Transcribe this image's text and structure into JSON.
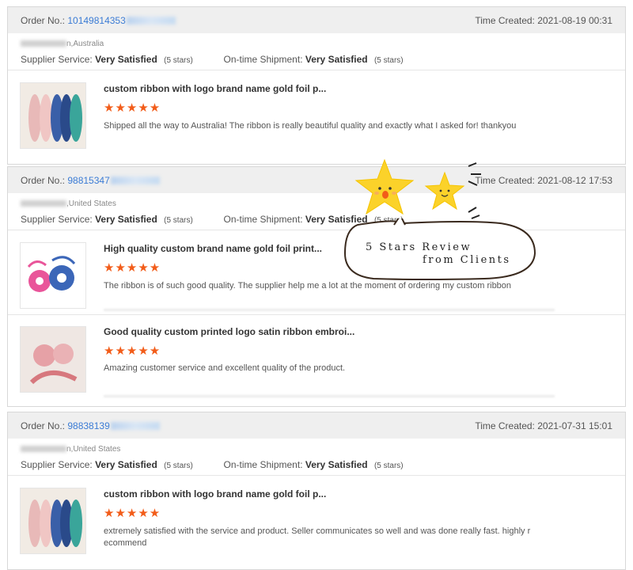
{
  "orders": [
    {
      "order_label": "Order No.:",
      "order_number": "10149814353",
      "time_label": "Time Created:",
      "time_value": "2021-08-19 00:31",
      "country": "n,Australia",
      "supplier_label": "Supplier Service:",
      "supplier_value": "Very Satisfied",
      "supplier_stars": "(5 stars)",
      "shipment_label": "On-time Shipment:",
      "shipment_value": "Very Satisfied",
      "shipment_stars": "(5 stars)",
      "products": [
        {
          "title": "custom ribbon with logo brand name gold foil p...",
          "stars": "★★★★★",
          "comment": "Shipped all the way to Australia! The ribbon is really beautiful quality and exactly what I asked for! thankyou",
          "thumb": "ribbon-rolls-photo"
        }
      ]
    },
    {
      "order_label": "Order No.:",
      "order_number": "98815347",
      "time_label": "Time Created:",
      "time_value": "2021-08-12 17:53",
      "country": ",United States",
      "supplier_label": "Supplier Service:",
      "supplier_value": "Very Satisfied",
      "supplier_stars": "(5 stars)",
      "shipment_label": "On-time Shipment:",
      "shipment_value": "Very Satisfied",
      "shipment_stars": "(5 stars)",
      "products": [
        {
          "title": "High quality custom brand name gold foil print...",
          "stars": "★★★★★",
          "comment": "The ribbon is of such good quality. The supplier help me a lot at the moment of ordering my custom ribbon",
          "thumb": "ribbon-spools-photo"
        },
        {
          "title": "Good quality custom printed logo satin ribbon embroi...",
          "stars": "★★★★★",
          "comment": "Amazing customer service and excellent quality of the product.",
          "thumb": "pink-ribbon-photo"
        }
      ]
    },
    {
      "order_label": "Order No.:",
      "order_number": "98838139",
      "time_label": "Time Created:",
      "time_value": "2021-07-31 15:01",
      "country": "n,United States",
      "supplier_label": "Supplier Service:",
      "supplier_value": "Very Satisfied",
      "supplier_stars": "(5 stars)",
      "shipment_label": "On-time Shipment:",
      "shipment_value": "Very Satisfied",
      "shipment_stars": "(5 stars)",
      "products": [
        {
          "title": "custom ribbon with logo brand name gold foil p...",
          "stars": "★★★★★",
          "comment": "extremely satisfied with the service and product. Seller communicates so well and was done really fast. highly recommend",
          "thumb": "ribbon-rolls-photo"
        }
      ]
    }
  ],
  "overlay": {
    "line1": "5 Stars Review",
    "line2": "from Clients",
    "star_color": "#fbd22a",
    "accent_star_color": "#f25c19",
    "link_color": "#3a7bd5"
  }
}
